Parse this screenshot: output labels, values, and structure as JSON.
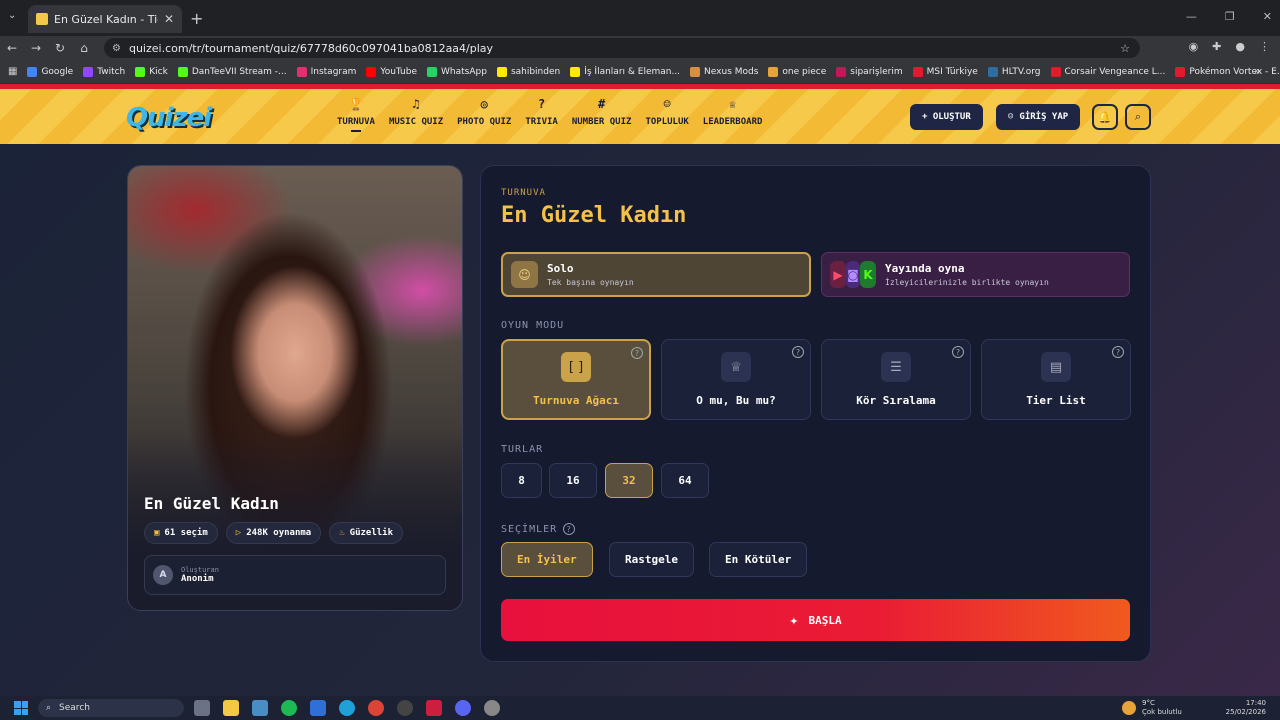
{
  "browser": {
    "tab_title": "En Güzel Kadın - Tier List, Kör S...",
    "url": "quizei.com/tr/tournament/quiz/67778d60c097041ba0812aa4/play",
    "bookmarks": [
      {
        "label": "Google",
        "color": "#4285f4"
      },
      {
        "label": "Twitch",
        "color": "#9146ff"
      },
      {
        "label": "Kick",
        "color": "#53fc18"
      },
      {
        "label": "DanTeeVII Stream -...",
        "color": "#53fc18"
      },
      {
        "label": "Instagram",
        "color": "#e1306c"
      },
      {
        "label": "YouTube",
        "color": "#ff0000"
      },
      {
        "label": "WhatsApp",
        "color": "#25d366"
      },
      {
        "label": "sahibinden",
        "color": "#ffe800"
      },
      {
        "label": "İş İlanları & Eleman...",
        "color": "#ffe800"
      },
      {
        "label": "Nexus Mods",
        "color": "#d98f40"
      },
      {
        "label": "one piece",
        "color": "#e8a23a"
      },
      {
        "label": "siparişlerim",
        "color": "#c2185b"
      },
      {
        "label": "MSI Türkiye",
        "color": "#e21b2c"
      },
      {
        "label": "HLTV.org",
        "color": "#2d6da3"
      },
      {
        "label": "Corsair Vengeance L...",
        "color": "#e21b2c"
      },
      {
        "label": "Pokémon Vortex - E...",
        "color": "#e21b2c"
      }
    ]
  },
  "site": {
    "logo": "Quizei",
    "nav": [
      {
        "icon": "🏆",
        "label": "TURNUVA"
      },
      {
        "icon": "♫",
        "label": "MUSIC QUIZ"
      },
      {
        "icon": "◎",
        "label": "PHOTO QUIZ"
      },
      {
        "icon": "?",
        "label": "TRIVIA"
      },
      {
        "icon": "#",
        "label": "NUMBER QUIZ"
      },
      {
        "icon": "☺",
        "label": "TOPLULUK"
      },
      {
        "icon": "♕",
        "label": "LEADERBOARD"
      }
    ],
    "create_label": "+ OLUŞTUR",
    "login_label": "GİRİŞ YAP"
  },
  "card": {
    "title": "En Güzel Kadın",
    "chips": [
      {
        "icon": "▣",
        "label": "61 seçim"
      },
      {
        "icon": "▷",
        "label": "248K oynanma"
      },
      {
        "icon": "♨",
        "label": "Güzellik"
      }
    ],
    "creator_label": "Oluşturan",
    "creator_initial": "A",
    "creator_name": "Anonim"
  },
  "panel": {
    "kicker": "TURNUVA",
    "title": "En Güzel Kadın",
    "play_modes": [
      {
        "title": "Solo",
        "subtitle": "Tek başına oynayın",
        "selected": true
      },
      {
        "title": "Yayında oyna",
        "subtitle": "İzleyicilerinizle birlikte oynayın",
        "selected": false
      }
    ],
    "game_mode_label": "OYUN MODU",
    "game_modes": [
      {
        "icon": "[ ]",
        "label": "Turnuva Ağacı",
        "selected": true
      },
      {
        "icon": "♕",
        "label": "O mu, Bu mu?",
        "selected": false
      },
      {
        "icon": "☰",
        "label": "Kör Sıralama",
        "selected": false
      },
      {
        "icon": "▤",
        "label": "Tier List",
        "selected": false
      }
    ],
    "rounds_label": "TURLAR",
    "rounds": [
      "8",
      "16",
      "32",
      "64"
    ],
    "selected_round": "32",
    "picks_label": "SEÇİMLER",
    "picks": [
      "En İyiler",
      "Rastgele",
      "En Kötüler"
    ],
    "selected_pick": "En İyiler",
    "start_label": "BAŞLA"
  },
  "taskbar": {
    "search_placeholder": "Search",
    "weather_temp": "9°C",
    "weather_desc": "Çok bulutlu",
    "time": "17:40",
    "date": "25/02/2026"
  }
}
